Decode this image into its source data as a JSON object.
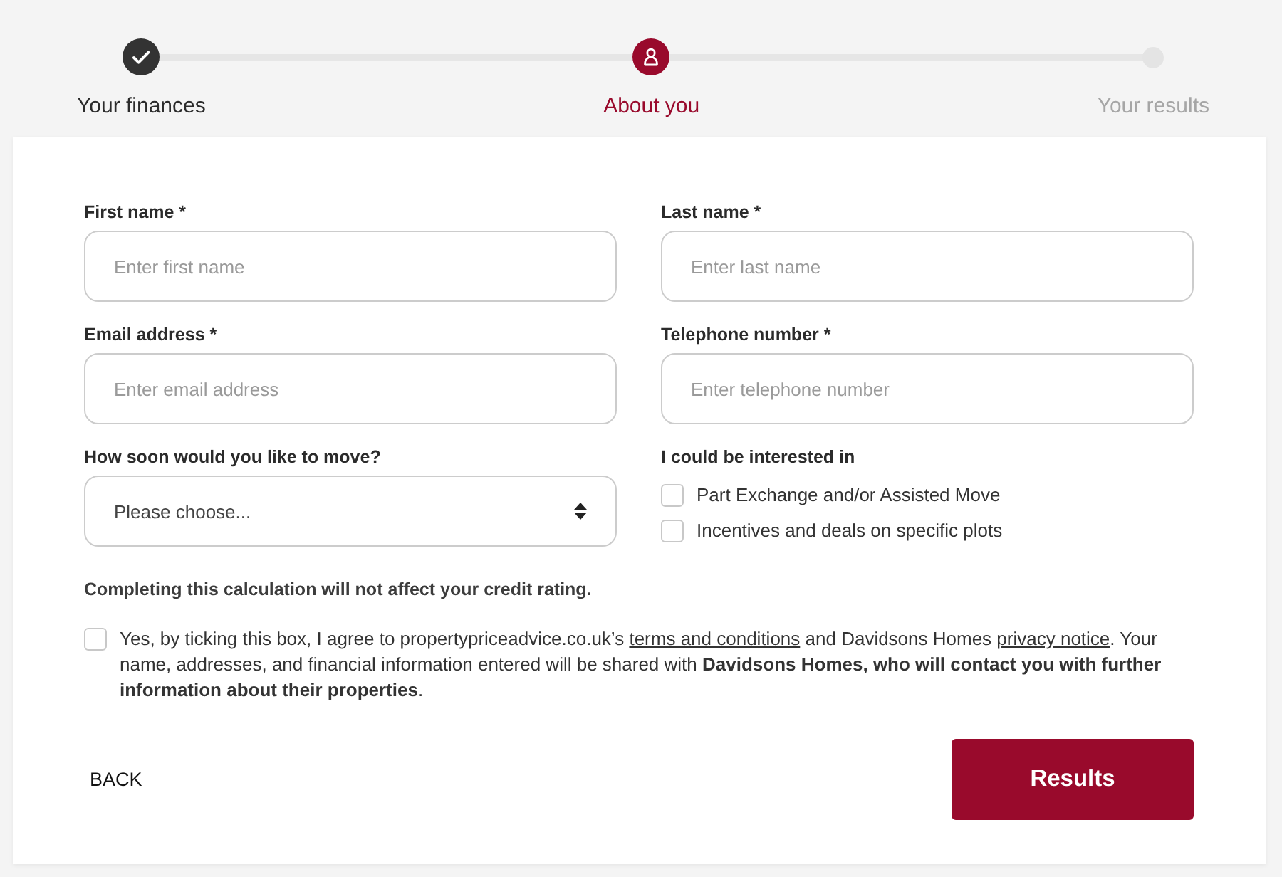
{
  "steps": [
    {
      "label": "Your finances",
      "done": true,
      "selected": false
    },
    {
      "label": "About you",
      "done": false,
      "selected": true
    },
    {
      "label": "Your results",
      "done": false,
      "selected": false
    }
  ],
  "form": {
    "fields": [
      {
        "kind": "text",
        "label": "First name *",
        "placeholder": "Enter first name"
      },
      {
        "kind": "text",
        "label": "Last name *",
        "placeholder": "Enter last name"
      },
      {
        "kind": "text",
        "label": "Email address *",
        "placeholder": "Enter email address"
      },
      {
        "kind": "text",
        "label": "Telephone number *",
        "placeholder": "Enter telephone number"
      },
      {
        "kind": "select",
        "label": "How soon would you like to move?",
        "value": "Please choose..."
      },
      {
        "kind": "checkboxes",
        "label": "I could be interested in",
        "options": [
          {
            "label": "Part Exchange and/or Assisted Move",
            "checked": false
          },
          {
            "label": "Incentives and deals on specific plots",
            "checked": false
          }
        ]
      }
    ],
    "note": "Completing this calculation will not affect your credit rating.",
    "consent": {
      "checked": false,
      "parts": [
        {
          "kind": "text",
          "text": "Yes, by ticking this box, I agree to propertypriceadvice.co.uk’s "
        },
        {
          "kind": "link",
          "text": "terms and conditions"
        },
        {
          "kind": "text",
          "text": " and Davidsons Homes "
        },
        {
          "kind": "link",
          "text": "privacy notice"
        },
        {
          "kind": "text",
          "text": ". Your name, addresses, and financial information entered will be shared with **Davidsons Homes, who will contact you with further information about their properties**."
        }
      ]
    },
    "actions": [
      {
        "kind": "back",
        "label": "BACK"
      },
      {
        "kind": "primary",
        "label": "Results"
      }
    ]
  }
}
